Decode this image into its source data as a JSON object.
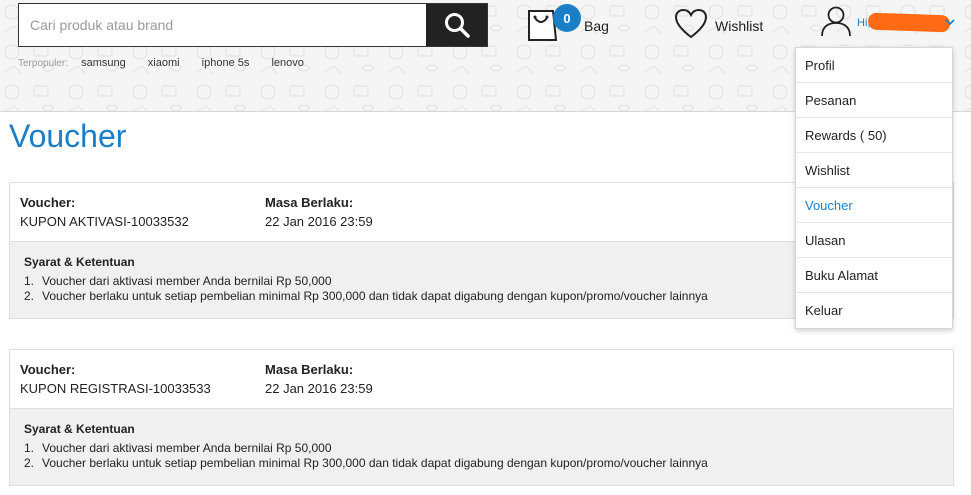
{
  "search": {
    "placeholder": "Cari produk atau brand"
  },
  "popular": {
    "label": "Terpopuler:",
    "terms": [
      "samsung",
      "xiaomi",
      "iphone 5s",
      "lenovo"
    ]
  },
  "bag": {
    "count": "0",
    "label": "Bag"
  },
  "wishlist": {
    "label": "Wishlist"
  },
  "account": {
    "greeting": "Hi,"
  },
  "menu": {
    "items": [
      "Profil",
      "Pesanan",
      "Rewards ( 50)",
      "Wishlist",
      "Voucher",
      "Ulasan",
      "Buku Alamat",
      "Keluar"
    ],
    "active": "Voucher"
  },
  "page": {
    "title": "Voucher"
  },
  "vouchers": [
    {
      "voucher_label": "Voucher:",
      "code": "KUPON AKTIVASI-10033532",
      "validity_label": "Masa Berlaku:",
      "validity": "22 Jan 2016 23:59",
      "terms_title": "Syarat & Ketentuan",
      "terms": [
        "Voucher dari aktivasi member Anda bernilai Rp 50,000",
        "Voucher berlaku untuk setiap pembelian minimal Rp 300,000 dan tidak dapat digabung dengan kupon/promo/voucher lainnya"
      ]
    },
    {
      "voucher_label": "Voucher:",
      "code": "KUPON REGISTRASI-10033533",
      "validity_label": "Masa Berlaku:",
      "validity": "22 Jan 2016 23:59",
      "terms_title": "Syarat & Ketentuan",
      "terms": [
        "Voucher dari aktivasi member Anda bernilai Rp 50,000",
        "Voucher berlaku untuk setiap pembelian minimal Rp 300,000 dan tidak dapat digabung dengan kupon/promo/voucher lainnya"
      ]
    }
  ],
  "colors": {
    "accent": "#1b7fc7",
    "redaction": "#ff6a14",
    "search_button": "#222222"
  },
  "icons": {
    "search_button": "search-icon",
    "bag": "shopping-bag-icon",
    "wishlist": "heart-icon",
    "account": "user-icon",
    "account_menu": "chevron-down-icon"
  }
}
